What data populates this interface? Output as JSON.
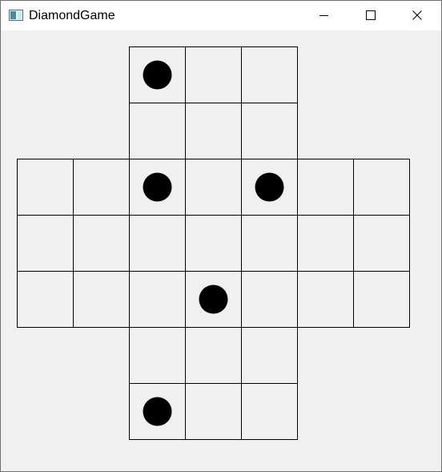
{
  "window": {
    "title": "DiamondGame",
    "icon": "app-window-icon",
    "controls": [
      "minimize-icon",
      "maximize-icon",
      "close-icon"
    ]
  },
  "board": {
    "rows": 7,
    "cols": 7,
    "cells": [
      [
        0,
        0,
        1,
        1,
        1,
        0,
        0
      ],
      [
        0,
        0,
        1,
        1,
        1,
        0,
        0
      ],
      [
        1,
        1,
        1,
        1,
        1,
        1,
        1
      ],
      [
        1,
        1,
        1,
        1,
        1,
        1,
        1
      ],
      [
        1,
        1,
        1,
        1,
        1,
        1,
        1
      ],
      [
        0,
        0,
        1,
        1,
        1,
        0,
        0
      ],
      [
        0,
        0,
        1,
        1,
        1,
        0,
        0
      ]
    ],
    "pieces": [
      {
        "row": 0,
        "col": 2
      },
      {
        "row": 2,
        "col": 2
      },
      {
        "row": 2,
        "col": 4
      },
      {
        "row": 4,
        "col": 3
      },
      {
        "row": 6,
        "col": 2
      }
    ],
    "colors": {
      "background": "#f0f0f0",
      "grid": "#000000",
      "piece": "#000000"
    }
  }
}
